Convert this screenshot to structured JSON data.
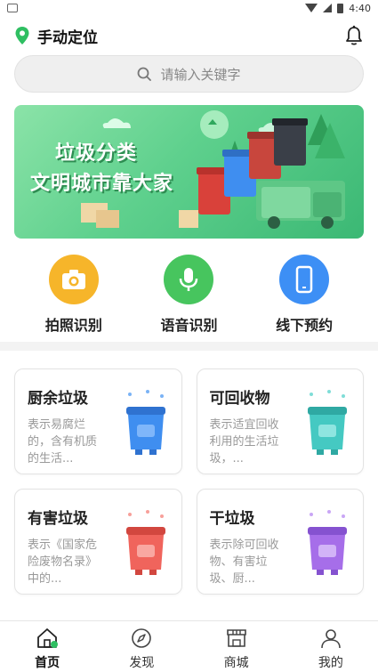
{
  "status_bar": {
    "time": "4:40"
  },
  "header": {
    "location_label": "手动定位"
  },
  "search": {
    "placeholder": "请输入关键字"
  },
  "banner": {
    "line1": "垃圾分类",
    "line2": "文明城市靠大家"
  },
  "quick_actions": [
    {
      "label": "拍照识别",
      "icon": "camera-icon",
      "color": "#f5b324"
    },
    {
      "label": "语音识别",
      "icon": "microphone-icon",
      "color": "#45c45c"
    },
    {
      "label": "线下预约",
      "icon": "phone-icon",
      "color": "#3d8ff5"
    }
  ],
  "categories": [
    {
      "title": "厨余垃圾",
      "desc": "表示易腐烂的，含有机质的生活...",
      "color": "#3f8ef0"
    },
    {
      "title": "可回收物",
      "desc": "表示适宜回收利用的生活垃圾，...",
      "color": "#3fc7c0"
    },
    {
      "title": "有害垃圾",
      "desc": "表示《国家危险废物名录》中的...",
      "color": "#f0625a"
    },
    {
      "title": "干垃圾",
      "desc": "表示除可回收物、有害垃圾、厨...",
      "color": "#a26ae8"
    }
  ],
  "tabs": [
    {
      "label": "首页",
      "icon": "home-icon"
    },
    {
      "label": "发现",
      "icon": "compass-icon"
    },
    {
      "label": "商城",
      "icon": "store-icon"
    },
    {
      "label": "我的",
      "icon": "user-icon"
    }
  ],
  "colors": {
    "accent": "#2fbf62",
    "banner_green": "#5ed08d"
  }
}
